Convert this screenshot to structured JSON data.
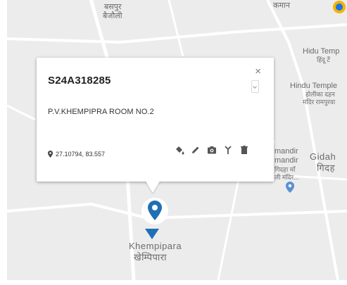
{
  "map": {
    "labels": {
      "basapur_1": "बसपुर",
      "basapur_2": "बैजौली",
      "top_right": "कमान",
      "hindu_temple_top_1": "Hidu Temp",
      "hindu_temple_top_2": "हिंदू टें",
      "hindu_temple_1": "Hindu Temple",
      "hindu_temple_2": "होलीका दहन",
      "hindu_temple_3": "मंदिर रामपुरवा",
      "mandir_1": "mandir",
      "mandir_2": "mandir",
      "mandir_3": "गिदहा माँ",
      "mandir_4": "ली मंदिर...",
      "gidah_1": "Gidah",
      "gidah_2": "गिदह",
      "khempipara_1": "Khempipara",
      "khempipara_2": "खेम्पिपारा"
    },
    "colors": {
      "marker": "#1f6fb5",
      "poi": "#5b8fd6",
      "background": "#ececec",
      "road": "#ffffff"
    }
  },
  "popup": {
    "title": "S24A318285",
    "close_label": "×",
    "address": "P.V.KHEMPIPRA ROOM NO.2",
    "coordinates": "27.10794, 83.557",
    "tools": [
      "paint-bucket-icon",
      "pencil-icon",
      "camera-icon",
      "antenna-icon",
      "trash-icon"
    ]
  }
}
